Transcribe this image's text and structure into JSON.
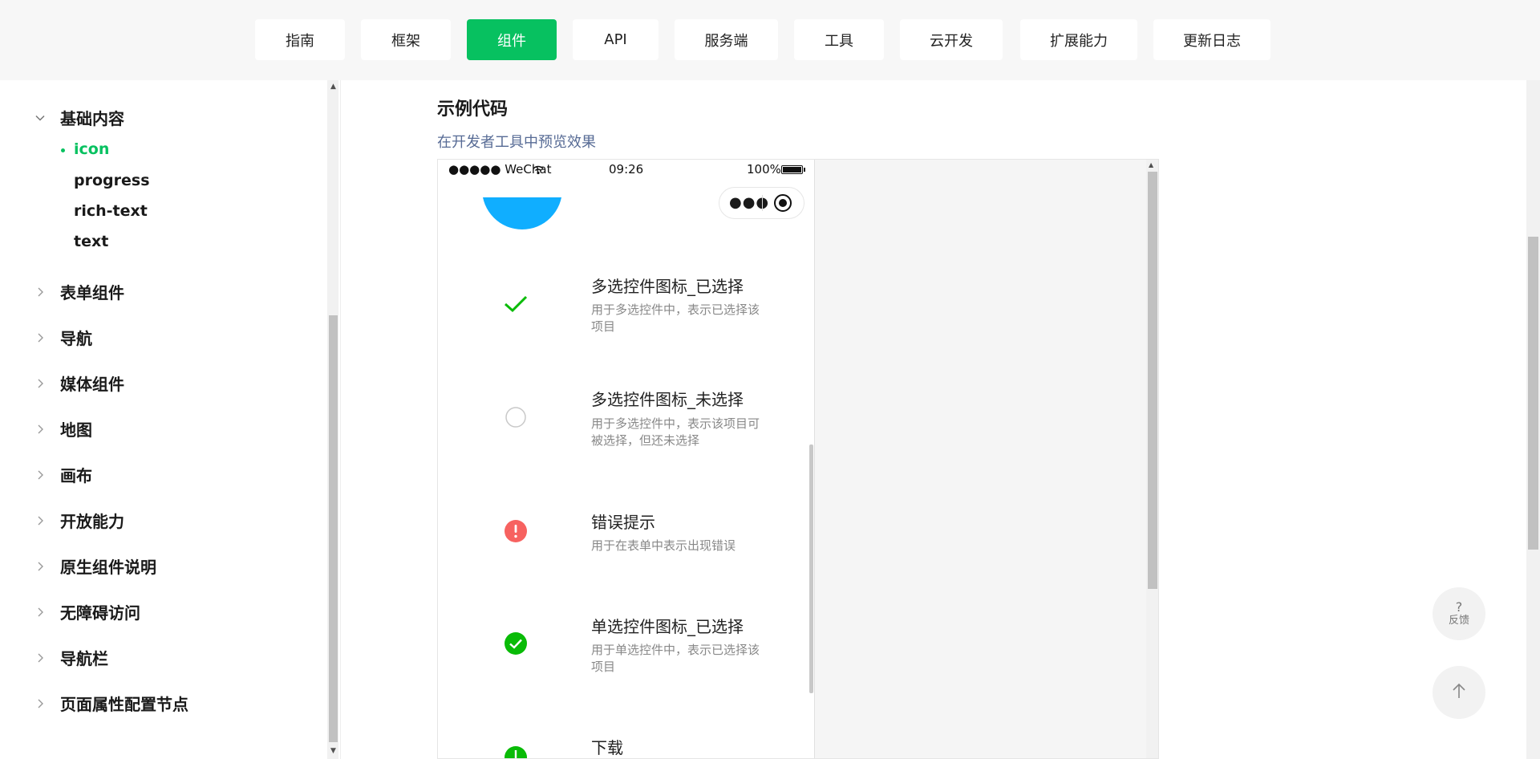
{
  "nav": {
    "tabs": [
      {
        "label": "指南"
      },
      {
        "label": "框架"
      },
      {
        "label": "组件",
        "active": true
      },
      {
        "label": "API"
      },
      {
        "label": "服务端"
      },
      {
        "label": "工具"
      },
      {
        "label": "云开发"
      },
      {
        "label": "扩展能力"
      },
      {
        "label": "更新日志"
      }
    ],
    "accent_color": "#07c160"
  },
  "sidebar": {
    "expanded_group": {
      "label": "基础内容",
      "items": [
        {
          "label": "icon",
          "active": true
        },
        {
          "label": "progress"
        },
        {
          "label": "rich-text"
        },
        {
          "label": "text"
        }
      ]
    },
    "groups": [
      {
        "label": "表单组件"
      },
      {
        "label": "导航"
      },
      {
        "label": "媒体组件"
      },
      {
        "label": "地图"
      },
      {
        "label": "画布"
      },
      {
        "label": "开放能力"
      },
      {
        "label": "原生组件说明"
      },
      {
        "label": "无障碍访问"
      },
      {
        "label": "导航栏"
      },
      {
        "label": "页面属性配置节点"
      }
    ]
  },
  "main": {
    "section_title": "示例代码",
    "preview_link": "在开发者工具中预览效果"
  },
  "phone": {
    "status": {
      "carrier": "●●●●● WeChat",
      "time": "09:26",
      "battery": "100%"
    },
    "capsule": {
      "more_icon": "more-dots-icon",
      "record_icon": "record-icon"
    },
    "rows": [
      {
        "icon": "success-no-circle-icon",
        "title": "多选控件图标_已选择",
        "desc": "用于多选控件中，表示已选择该项目"
      },
      {
        "icon": "circle-icon",
        "title": "多选控件图标_未选择",
        "desc": "用于多选控件中，表示该项目可被选择，但还未选择"
      },
      {
        "icon": "warn-icon",
        "title": "错误提示",
        "desc": "用于在表单中表示出现错误"
      },
      {
        "icon": "success-icon",
        "title": "单选控件图标_已选择",
        "desc": "用于单选控件中，表示已选择该项目"
      },
      {
        "icon": "download-icon",
        "title": "下载",
        "desc": ""
      }
    ],
    "colors": {
      "green": "#09bb07",
      "warn": "#f76260",
      "info_blue": "#10aeff",
      "circle_gray": "#c9c9c9"
    }
  },
  "floating": {
    "feedback_glyph": "?",
    "feedback_label": "反馈",
    "back_to_top_icon": "arrow-up-icon"
  }
}
